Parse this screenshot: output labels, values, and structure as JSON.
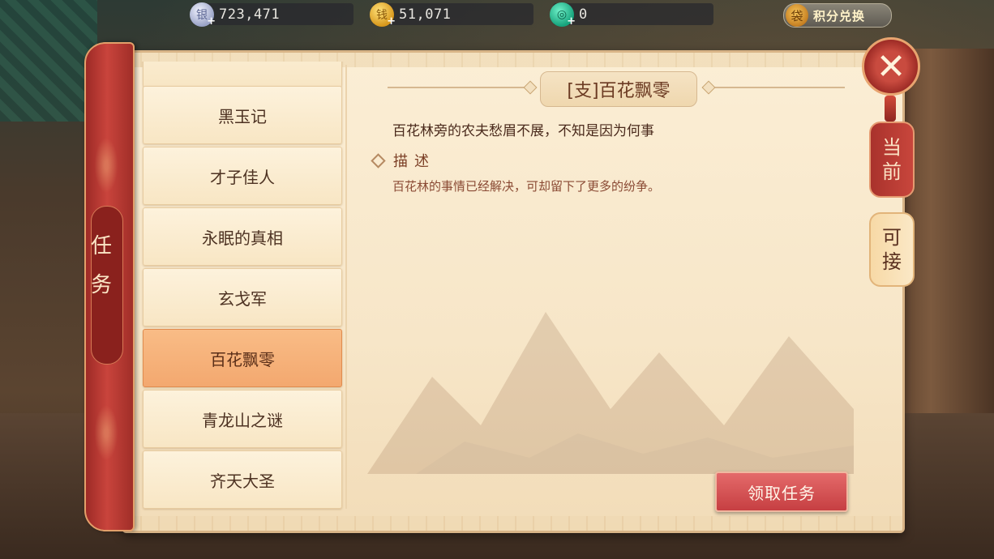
{
  "currencies": {
    "silver": {
      "value": "723,471",
      "icon": "silver-coin-icon",
      "glyph": "银"
    },
    "gold": {
      "value": "51,071",
      "icon": "gold-coin-icon",
      "glyph": "钱"
    },
    "jade": {
      "value": "0",
      "icon": "jade-icon",
      "glyph": "◎"
    }
  },
  "points_exchange": {
    "label": "积分兑换",
    "icon": "money-bag-icon"
  },
  "side_scroll": {
    "label": "任务"
  },
  "quests": [
    {
      "label": "黑玉记"
    },
    {
      "label": "才子佳人"
    },
    {
      "label": "永眠的真相"
    },
    {
      "label": "玄戈军"
    },
    {
      "label": "百花飘零",
      "selected": true
    },
    {
      "label": "青龙山之谜"
    },
    {
      "label": "齐天大圣"
    }
  ],
  "detail": {
    "title": "[支]百花飘零",
    "summary": "百花林旁的农夫愁眉不展，不知是因为何事",
    "desc_heading": "描述",
    "desc_text": "百花林的事情已经解决，可却留下了更多的纷争。"
  },
  "accept_button": {
    "label": "领取任务"
  },
  "close": {
    "label": "✕"
  },
  "tabs": {
    "current": {
      "line1": "当",
      "line2": "前"
    },
    "available": {
      "line1": "可",
      "line2": "接"
    }
  },
  "colors": {
    "accent_red": "#c63f42",
    "parchment": "#f7e6c8",
    "selected": "#f3a86f"
  }
}
